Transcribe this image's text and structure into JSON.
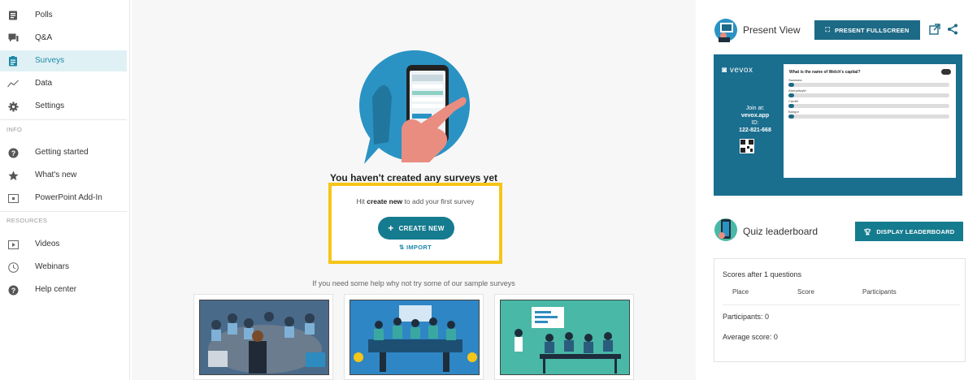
{
  "sidebar": {
    "items": [
      {
        "label": "Polls",
        "icon": "polls-icon"
      },
      {
        "label": "Q&A",
        "icon": "qa-icon"
      },
      {
        "label": "Surveys",
        "icon": "surveys-icon",
        "active": true
      },
      {
        "label": "Data",
        "icon": "data-icon"
      },
      {
        "label": "Settings",
        "icon": "gear-icon"
      }
    ],
    "info_label": "INFO",
    "info_items": [
      {
        "label": "Getting started",
        "icon": "help-circle-icon"
      },
      {
        "label": "What's new",
        "icon": "star-icon"
      },
      {
        "label": "PowerPoint Add-In",
        "icon": "powerpoint-icon"
      }
    ],
    "resources_label": "RESOURCES",
    "resource_items": [
      {
        "label": "Videos",
        "icon": "video-icon"
      },
      {
        "label": "Webinars",
        "icon": "clock-icon"
      },
      {
        "label": "Help center",
        "icon": "help-circle-icon"
      }
    ]
  },
  "main": {
    "empty_title": "You haven't created any surveys yet",
    "hint_prefix": "Hit ",
    "hint_bold": "create new",
    "hint_suffix": " to add your first survey",
    "create_label": "CREATE NEW",
    "import_label": "IMPORT",
    "help_text": "If you need some help why not try some of our sample surveys"
  },
  "present_view": {
    "title": "Present View",
    "fullscreen_label": "PRESENT FULLSCREEN",
    "preview": {
      "logo": "vevox",
      "join_line1": "Join at:",
      "join_line2": "vevox.app",
      "id_label": "ID:",
      "id_value": "122-821-668",
      "question": "What is the name of Welch's capital?",
      "options": [
        "Swansea",
        "Aberystwyth",
        "Cardiff",
        "Bangor"
      ]
    }
  },
  "leaderboard": {
    "title": "Quiz leaderboard",
    "button_label": "DISPLAY LEADERBOARD",
    "scores_text": "Scores after 1 questions",
    "columns": [
      "Place",
      "Score",
      "Participants"
    ],
    "participants_text": "Participants: 0",
    "average_text": "Average score: 0"
  },
  "colors": {
    "accent": "#157b8e",
    "highlight": "#f5c518",
    "preview_bg": "#1a6e8e",
    "active_nav_bg": "#e0f1f5"
  }
}
